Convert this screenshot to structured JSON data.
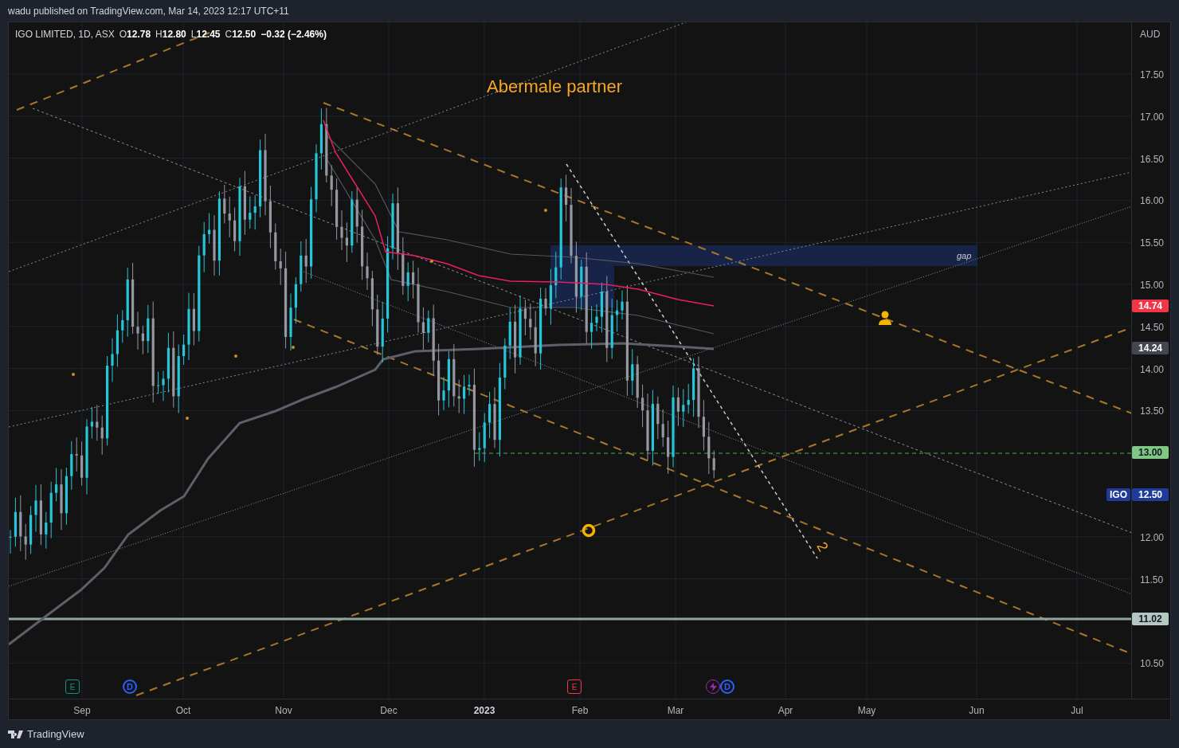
{
  "header": {
    "text": "wadu published on TradingView.com, Mar 14, 2023 12:17 UTC+11"
  },
  "legend": {
    "title": "IGO LIMITED, 1D, ASX",
    "values": [
      {
        "label": "O",
        "value": "12.78"
      },
      {
        "label": "H",
        "value": "12.80"
      },
      {
        "label": "L",
        "value": "12.45"
      },
      {
        "label": "C",
        "value": "12.50"
      }
    ],
    "change": "−0.32 (−2.46%)"
  },
  "annotations": [
    {
      "kind": "title",
      "text": "Abermale partner"
    },
    {
      "kind": "zone",
      "text": "gap"
    },
    {
      "kind": "wave",
      "text": "2"
    }
  ],
  "price_axis": {
    "currency": "AUD",
    "ticks": [
      "17.50",
      "17.00",
      "16.50",
      "16.00",
      "15.50",
      "15.00",
      "14.50",
      "14.00",
      "13.50",
      "12.00",
      "11.50",
      "10.50"
    ]
  },
  "price_labels": [
    {
      "price": "14.74",
      "color": "#f23645"
    },
    {
      "price": "14.24",
      "color": "#434651"
    },
    {
      "price": "13.00",
      "color": "#81c784"
    },
    {
      "symbol": "IGO",
      "price": "12.50",
      "color": "#1e3a9a"
    },
    {
      "price": "11.02",
      "color": "#b2c8c0"
    }
  ],
  "time_axis": [
    {
      "label": "Sep",
      "bold": false
    },
    {
      "label": "Oct",
      "bold": false
    },
    {
      "label": "Nov",
      "bold": false
    },
    {
      "label": "Dec",
      "bold": false
    },
    {
      "label": "2023",
      "bold": true
    },
    {
      "label": "Feb",
      "bold": false
    },
    {
      "label": "Mar",
      "bold": false
    },
    {
      "label": "Apr",
      "bold": false
    },
    {
      "label": "May",
      "bold": false
    },
    {
      "label": "Jun",
      "bold": false
    },
    {
      "label": "Jul",
      "bold": false
    }
  ],
  "events": [
    {
      "kind": "earnings",
      "letter": "E",
      "color": "#089981"
    },
    {
      "kind": "dividend",
      "letter": "D",
      "color": "#2962ff"
    },
    {
      "kind": "earnings",
      "letter": "E",
      "color": "#f23645"
    },
    {
      "kind": "flash",
      "color": "#9c27b0"
    },
    {
      "kind": "dividend",
      "letter": "D",
      "color": "#2962ff"
    }
  ],
  "footer": {
    "brand": "TradingView"
  }
}
